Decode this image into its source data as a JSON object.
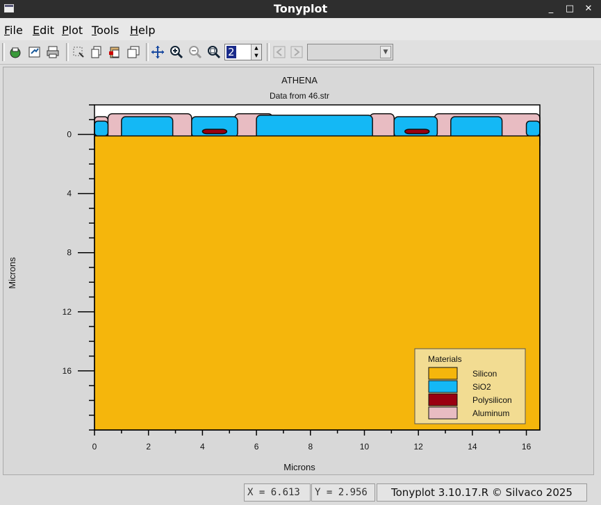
{
  "window": {
    "title": "Tonyplot",
    "minimize": "_",
    "maximize": "□",
    "close": "✕"
  },
  "menubar": [
    {
      "key": "F",
      "rest": "ile"
    },
    {
      "key": "E",
      "rest": "dit"
    },
    {
      "key": "P",
      "rest": "lot"
    },
    {
      "key": "T",
      "rest": "ools"
    },
    {
      "key": "H",
      "rest": "elp"
    }
  ],
  "toolbar": {
    "spinner_value": "2",
    "combo_value": ""
  },
  "plot": {
    "title": "ATHENA",
    "subtitle": "Data from 46.str",
    "xlabel": "Microns",
    "ylabel": "Microns"
  },
  "legend": {
    "title": "Materials",
    "items": [
      {
        "label": "Silicon",
        "color": "#f5b60c"
      },
      {
        "label": "SiO2",
        "color": "#14b8f5"
      },
      {
        "label": "Polysilicon",
        "color": "#9a0010"
      },
      {
        "label": "Aluminum",
        "color": "#e8bcc2"
      }
    ]
  },
  "chart_data": {
    "type": "structure",
    "xlim": [
      0,
      16.5
    ],
    "ylim": [
      -2.0,
      20.0
    ],
    "y_inverted": true,
    "x_ticks": [
      0,
      2,
      4,
      6,
      8,
      10,
      12,
      14,
      16
    ],
    "y_ticks": [
      0,
      4,
      8,
      12,
      16
    ],
    "regions": [
      {
        "material": "Aluminum",
        "x": [
          0,
          0.5
        ],
        "top": -1.2,
        "bottom": 0.9
      },
      {
        "material": "Aluminum",
        "x": [
          0.5,
          3.6
        ],
        "top": -1.4,
        "bottom": 1.0
      },
      {
        "material": "Aluminum",
        "x": [
          5.2,
          6.6
        ],
        "top": -1.4,
        "bottom": 1.0
      },
      {
        "material": "Aluminum",
        "x": [
          10.2,
          11.1
        ],
        "top": -1.4,
        "bottom": 1.0
      },
      {
        "material": "Aluminum",
        "x": [
          12.6,
          16.5
        ],
        "top": -1.4,
        "bottom": 1.0
      },
      {
        "material": "SiO2",
        "x": [
          0,
          0.5
        ],
        "top": -0.9,
        "bottom": 0.1
      },
      {
        "material": "SiO2",
        "x": [
          1.0,
          2.9
        ],
        "top": -1.2,
        "bottom": 0.4
      },
      {
        "material": "SiO2",
        "x": [
          3.6,
          5.3
        ],
        "top": -1.2,
        "bottom": 0.2
      },
      {
        "material": "SiO2",
        "x": [
          6.0,
          10.3
        ],
        "top": -1.3,
        "bottom": 0.5
      },
      {
        "material": "SiO2",
        "x": [
          11.1,
          12.7
        ],
        "top": -1.2,
        "bottom": 0.2
      },
      {
        "material": "SiO2",
        "x": [
          13.2,
          15.1
        ],
        "top": -1.2,
        "bottom": 0.4
      },
      {
        "material": "SiO2",
        "x": [
          16.0,
          16.5
        ],
        "top": -0.9,
        "bottom": 0.1
      },
      {
        "material": "Polysilicon",
        "x": [
          4.0,
          4.9
        ],
        "top": -0.35,
        "bottom": -0.05
      },
      {
        "material": "Polysilicon",
        "x": [
          11.5,
          12.4
        ],
        "top": -0.35,
        "bottom": -0.05
      },
      {
        "material": "Silicon",
        "x": [
          0,
          16.5
        ],
        "top": 0.1,
        "bottom": 20.0
      }
    ]
  },
  "status": {
    "x_readout": "X = 6.613",
    "y_readout": "Y = 2.956",
    "version": "Tonyplot 3.10.17.R © Silvaco 2025"
  }
}
